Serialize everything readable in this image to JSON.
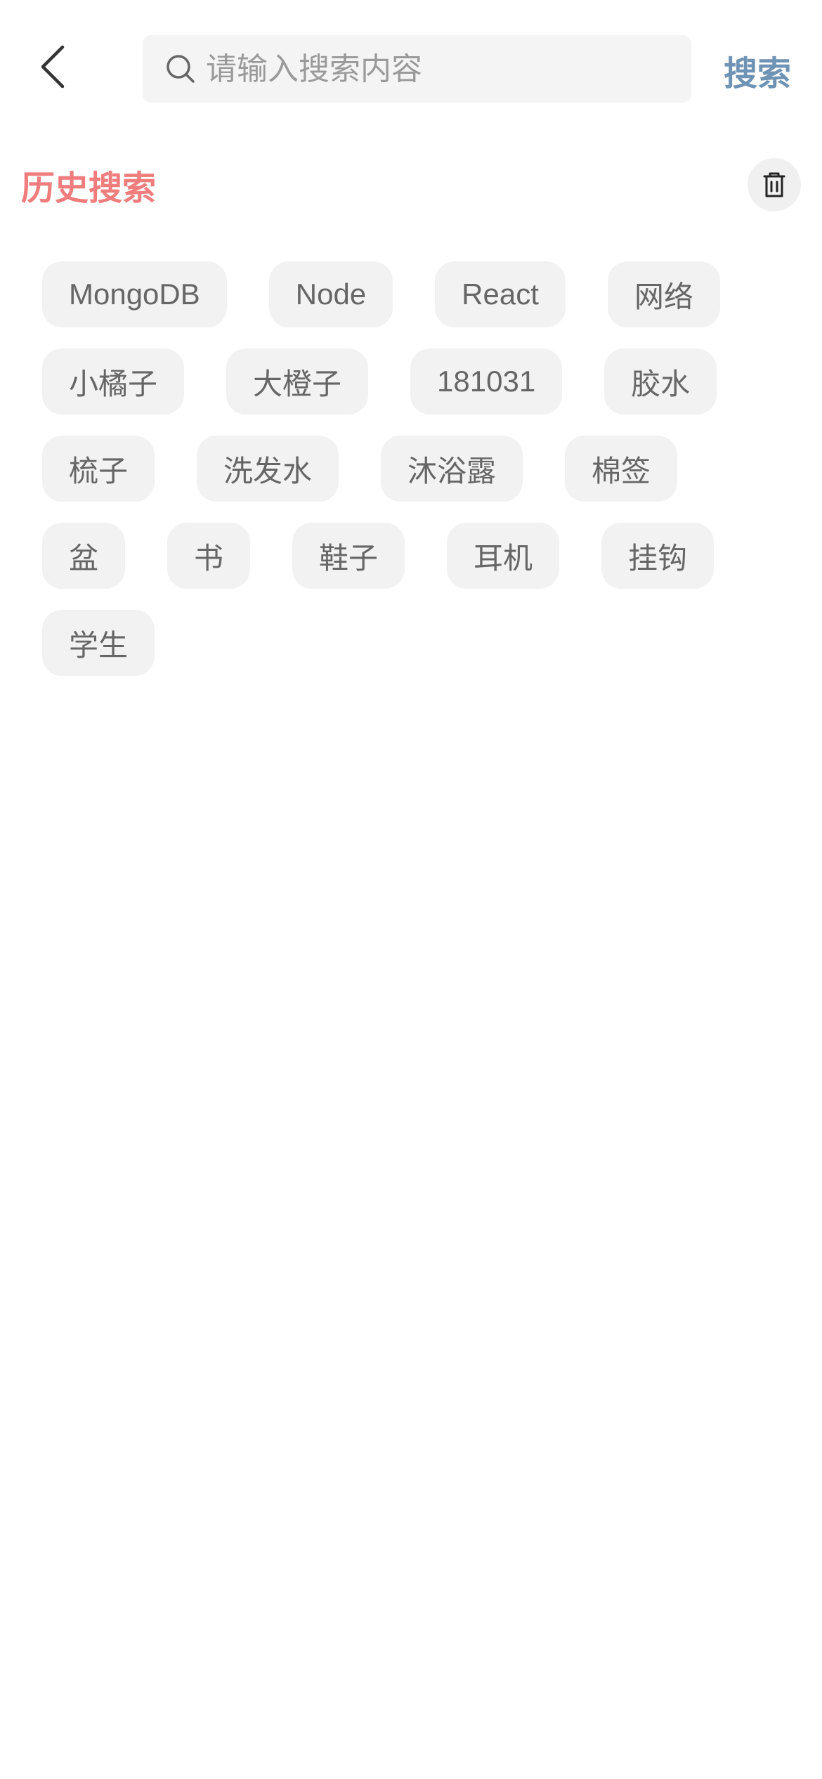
{
  "header": {
    "back_icon": "chevron-left-icon",
    "search": {
      "icon": "search-icon",
      "placeholder": "请输入搜索内容",
      "value": ""
    },
    "search_button_label": "搜索"
  },
  "history": {
    "title": "历史搜索",
    "clear_icon": "trash-icon",
    "title_color": "#f07d7d",
    "tags": [
      "MongoDB",
      "Node",
      "React",
      "网络",
      "小橘子",
      "大橙子",
      "181031",
      "胶水",
      "梳子",
      "洗发水",
      "沐浴露",
      "棉签",
      "盆",
      "书",
      "鞋子",
      "耳机",
      "挂钩",
      "学生"
    ]
  },
  "colors": {
    "search_button": "#6f93b4",
    "tag_background": "#f2f2f2",
    "tag_text": "#666666"
  }
}
